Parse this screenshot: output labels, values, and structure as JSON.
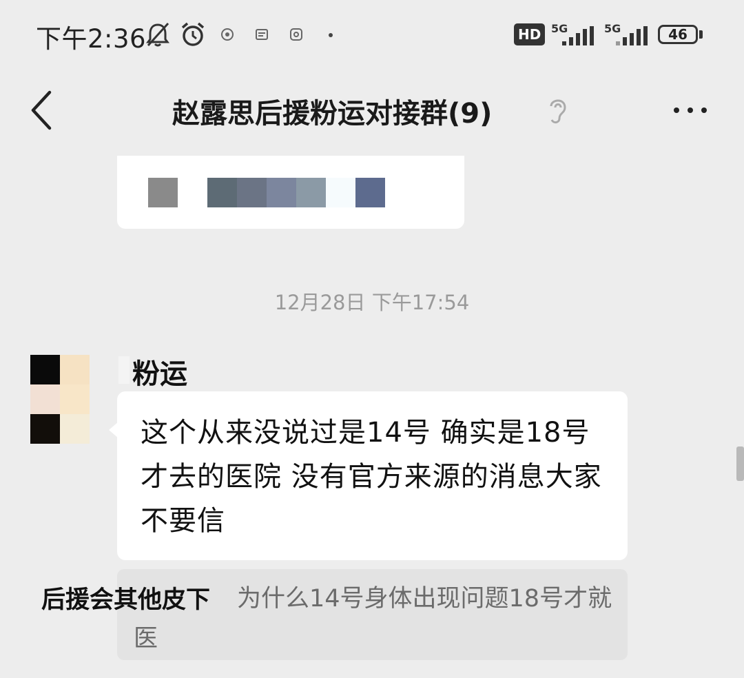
{
  "status_bar": {
    "time": "下午2:36",
    "network_hd": "HD",
    "network_1": "5G",
    "network_2": "5G",
    "battery": "46"
  },
  "nav": {
    "title": "赵露思后援粉运对接群(9)",
    "back_icon": "chevron-left-icon",
    "earpiece_icon": "ear-icon",
    "more_icon": "more-dots-icon"
  },
  "chat": {
    "timestamp": "12月28日 下午17:54",
    "message": {
      "sender": "粉运",
      "text": "这个从来没说过是14号 确实是18号才去的医院 没有官方来源的消息大家不要信"
    },
    "quote": {
      "name": "后援会其他皮下",
      "text": "为什么14号身体出现问题18号才就医"
    }
  },
  "colors": {
    "background": "#ededed",
    "bubble": "#ffffff",
    "quote_bg": "#e3e3e3",
    "timestamp": "#9a9a9a"
  }
}
